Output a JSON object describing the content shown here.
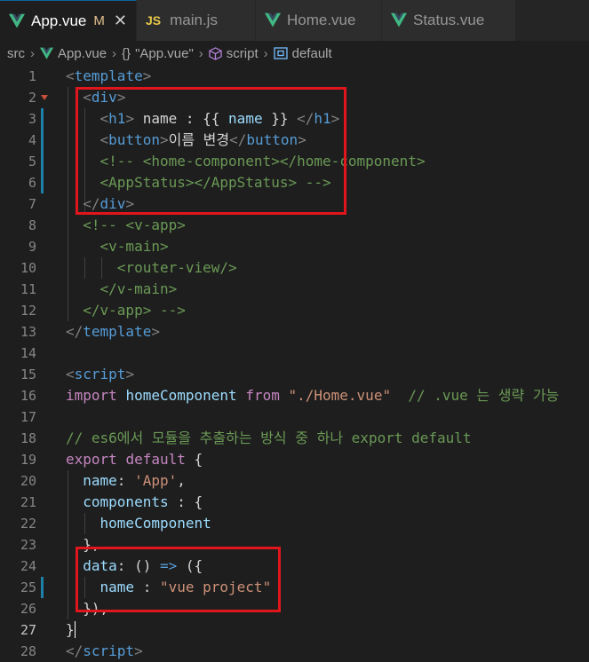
{
  "tabs": [
    {
      "label": "App.vue",
      "modified": "M",
      "close": "✕",
      "icon": "vue-icon",
      "active": true
    },
    {
      "label": "main.js",
      "icon": "js-icon",
      "icon_text": "JS"
    },
    {
      "label": "Home.vue",
      "icon": "vue-icon"
    },
    {
      "label": "Status.vue",
      "icon": "vue-icon"
    }
  ],
  "breadcrumb": {
    "folder": "src",
    "file": "App.vue",
    "module_icon": "{}",
    "module": "\"App.vue\"",
    "section": "script",
    "symbol": "default"
  },
  "editor": {
    "current_line": 27,
    "lines": [
      {
        "n": "1",
        "tokens": [
          [
            "t-punc",
            "<"
          ],
          [
            "t-tag",
            "template"
          ],
          [
            "t-punc",
            ">"
          ]
        ]
      },
      {
        "n": "2",
        "tokens": [
          [
            "t-text",
            "  "
          ],
          [
            "t-punc",
            "<"
          ],
          [
            "t-tag",
            "div"
          ],
          [
            "t-punc",
            ">"
          ]
        ]
      },
      {
        "n": "3",
        "tokens": [
          [
            "t-text",
            "    "
          ],
          [
            "t-punc",
            "<"
          ],
          [
            "t-tag",
            "h1"
          ],
          [
            "t-punc",
            ">"
          ],
          [
            "t-text",
            " name : {{ "
          ],
          [
            "t-var",
            "name"
          ],
          [
            "t-text",
            " }} "
          ],
          [
            "t-punc",
            "</"
          ],
          [
            "t-tag",
            "h1"
          ],
          [
            "t-punc",
            ">"
          ]
        ]
      },
      {
        "n": "4",
        "tokens": [
          [
            "t-text",
            "    "
          ],
          [
            "t-punc",
            "<"
          ],
          [
            "t-tag",
            "button"
          ],
          [
            "t-punc",
            ">"
          ],
          [
            "t-text",
            "이름 변경"
          ],
          [
            "t-punc",
            "</"
          ],
          [
            "t-tag",
            "button"
          ],
          [
            "t-punc",
            ">"
          ]
        ]
      },
      {
        "n": "5",
        "tokens": [
          [
            "t-text",
            "    "
          ],
          [
            "t-com",
            "<!-- <home-component></home-component>"
          ]
        ]
      },
      {
        "n": "6",
        "tokens": [
          [
            "t-text",
            "    "
          ],
          [
            "t-com",
            "<AppStatus></AppStatus> -->"
          ]
        ]
      },
      {
        "n": "7",
        "tokens": [
          [
            "t-text",
            "  "
          ],
          [
            "t-punc",
            "</"
          ],
          [
            "t-tag",
            "div"
          ],
          [
            "t-punc",
            ">"
          ]
        ]
      },
      {
        "n": "8",
        "tokens": [
          [
            "t-text",
            "  "
          ],
          [
            "t-com",
            "<!-- <v-app>"
          ]
        ]
      },
      {
        "n": "9",
        "tokens": [
          [
            "t-text",
            "    "
          ],
          [
            "t-com",
            "<v-main>"
          ]
        ]
      },
      {
        "n": "10",
        "tokens": [
          [
            "t-text",
            "      "
          ],
          [
            "t-com",
            "<router-view/>"
          ]
        ]
      },
      {
        "n": "11",
        "tokens": [
          [
            "t-text",
            "    "
          ],
          [
            "t-com",
            "</v-main>"
          ]
        ]
      },
      {
        "n": "12",
        "tokens": [
          [
            "t-text",
            "  "
          ],
          [
            "t-com",
            "</v-app> -->"
          ]
        ]
      },
      {
        "n": "13",
        "tokens": [
          [
            "t-punc",
            "</"
          ],
          [
            "t-tag",
            "template"
          ],
          [
            "t-punc",
            ">"
          ]
        ]
      },
      {
        "n": "14",
        "tokens": []
      },
      {
        "n": "15",
        "tokens": [
          [
            "t-punc",
            "<"
          ],
          [
            "t-tag",
            "script"
          ],
          [
            "t-punc",
            ">"
          ]
        ]
      },
      {
        "n": "16",
        "tokens": [
          [
            "t-kw",
            "import"
          ],
          [
            "t-text",
            " "
          ],
          [
            "t-var",
            "homeComponent"
          ],
          [
            "t-text",
            " "
          ],
          [
            "t-kw",
            "from"
          ],
          [
            "t-text",
            " "
          ],
          [
            "t-str",
            "\"./Home.vue\""
          ],
          [
            "t-text",
            "  "
          ],
          [
            "t-com",
            "// .vue 는 생략 가능"
          ]
        ]
      },
      {
        "n": "17",
        "tokens": []
      },
      {
        "n": "18",
        "tokens": [
          [
            "t-com",
            "// es6에서 모듈을 추출하는 방식 중 하나 export default"
          ]
        ]
      },
      {
        "n": "19",
        "tokens": [
          [
            "t-kw",
            "export"
          ],
          [
            "t-text",
            " "
          ],
          [
            "t-kw",
            "default"
          ],
          [
            "t-text",
            " {"
          ]
        ]
      },
      {
        "n": "20",
        "tokens": [
          [
            "t-text",
            "  "
          ],
          [
            "t-var",
            "name"
          ],
          [
            "t-text",
            ": "
          ],
          [
            "t-str",
            "'App'"
          ],
          [
            "t-text",
            ","
          ]
        ]
      },
      {
        "n": "21",
        "tokens": [
          [
            "t-text",
            "  "
          ],
          [
            "t-var",
            "components"
          ],
          [
            "t-text",
            " : {"
          ]
        ]
      },
      {
        "n": "22",
        "tokens": [
          [
            "t-text",
            "    "
          ],
          [
            "t-var",
            "homeComponent"
          ]
        ]
      },
      {
        "n": "23",
        "tokens": [
          [
            "t-text",
            "  },"
          ]
        ]
      },
      {
        "n": "24",
        "tokens": [
          [
            "t-text",
            "  "
          ],
          [
            "t-var",
            "data"
          ],
          [
            "t-text",
            ": () "
          ],
          [
            "t-kw2",
            "=>"
          ],
          [
            "t-text",
            " ({"
          ]
        ]
      },
      {
        "n": "25",
        "tokens": [
          [
            "t-text",
            "    "
          ],
          [
            "t-var",
            "name"
          ],
          [
            "t-text",
            " : "
          ],
          [
            "t-str",
            "\"vue project\""
          ]
        ]
      },
      {
        "n": "26",
        "tokens": [
          [
            "t-text",
            "  }),"
          ]
        ]
      },
      {
        "n": "27",
        "tokens": [
          [
            "t-text",
            "}"
          ]
        ]
      },
      {
        "n": "28",
        "tokens": [
          [
            "t-punc",
            "</"
          ],
          [
            "t-tag",
            "script"
          ],
          [
            "t-punc",
            ">"
          ]
        ]
      }
    ]
  },
  "colors": {
    "background": "#1e1e1e",
    "highlight_box": "#e0161c",
    "git_modified_bar": "#1b81a8",
    "vue_logo_outer": "#41b883",
    "vue_logo_inner": "#35495e"
  }
}
